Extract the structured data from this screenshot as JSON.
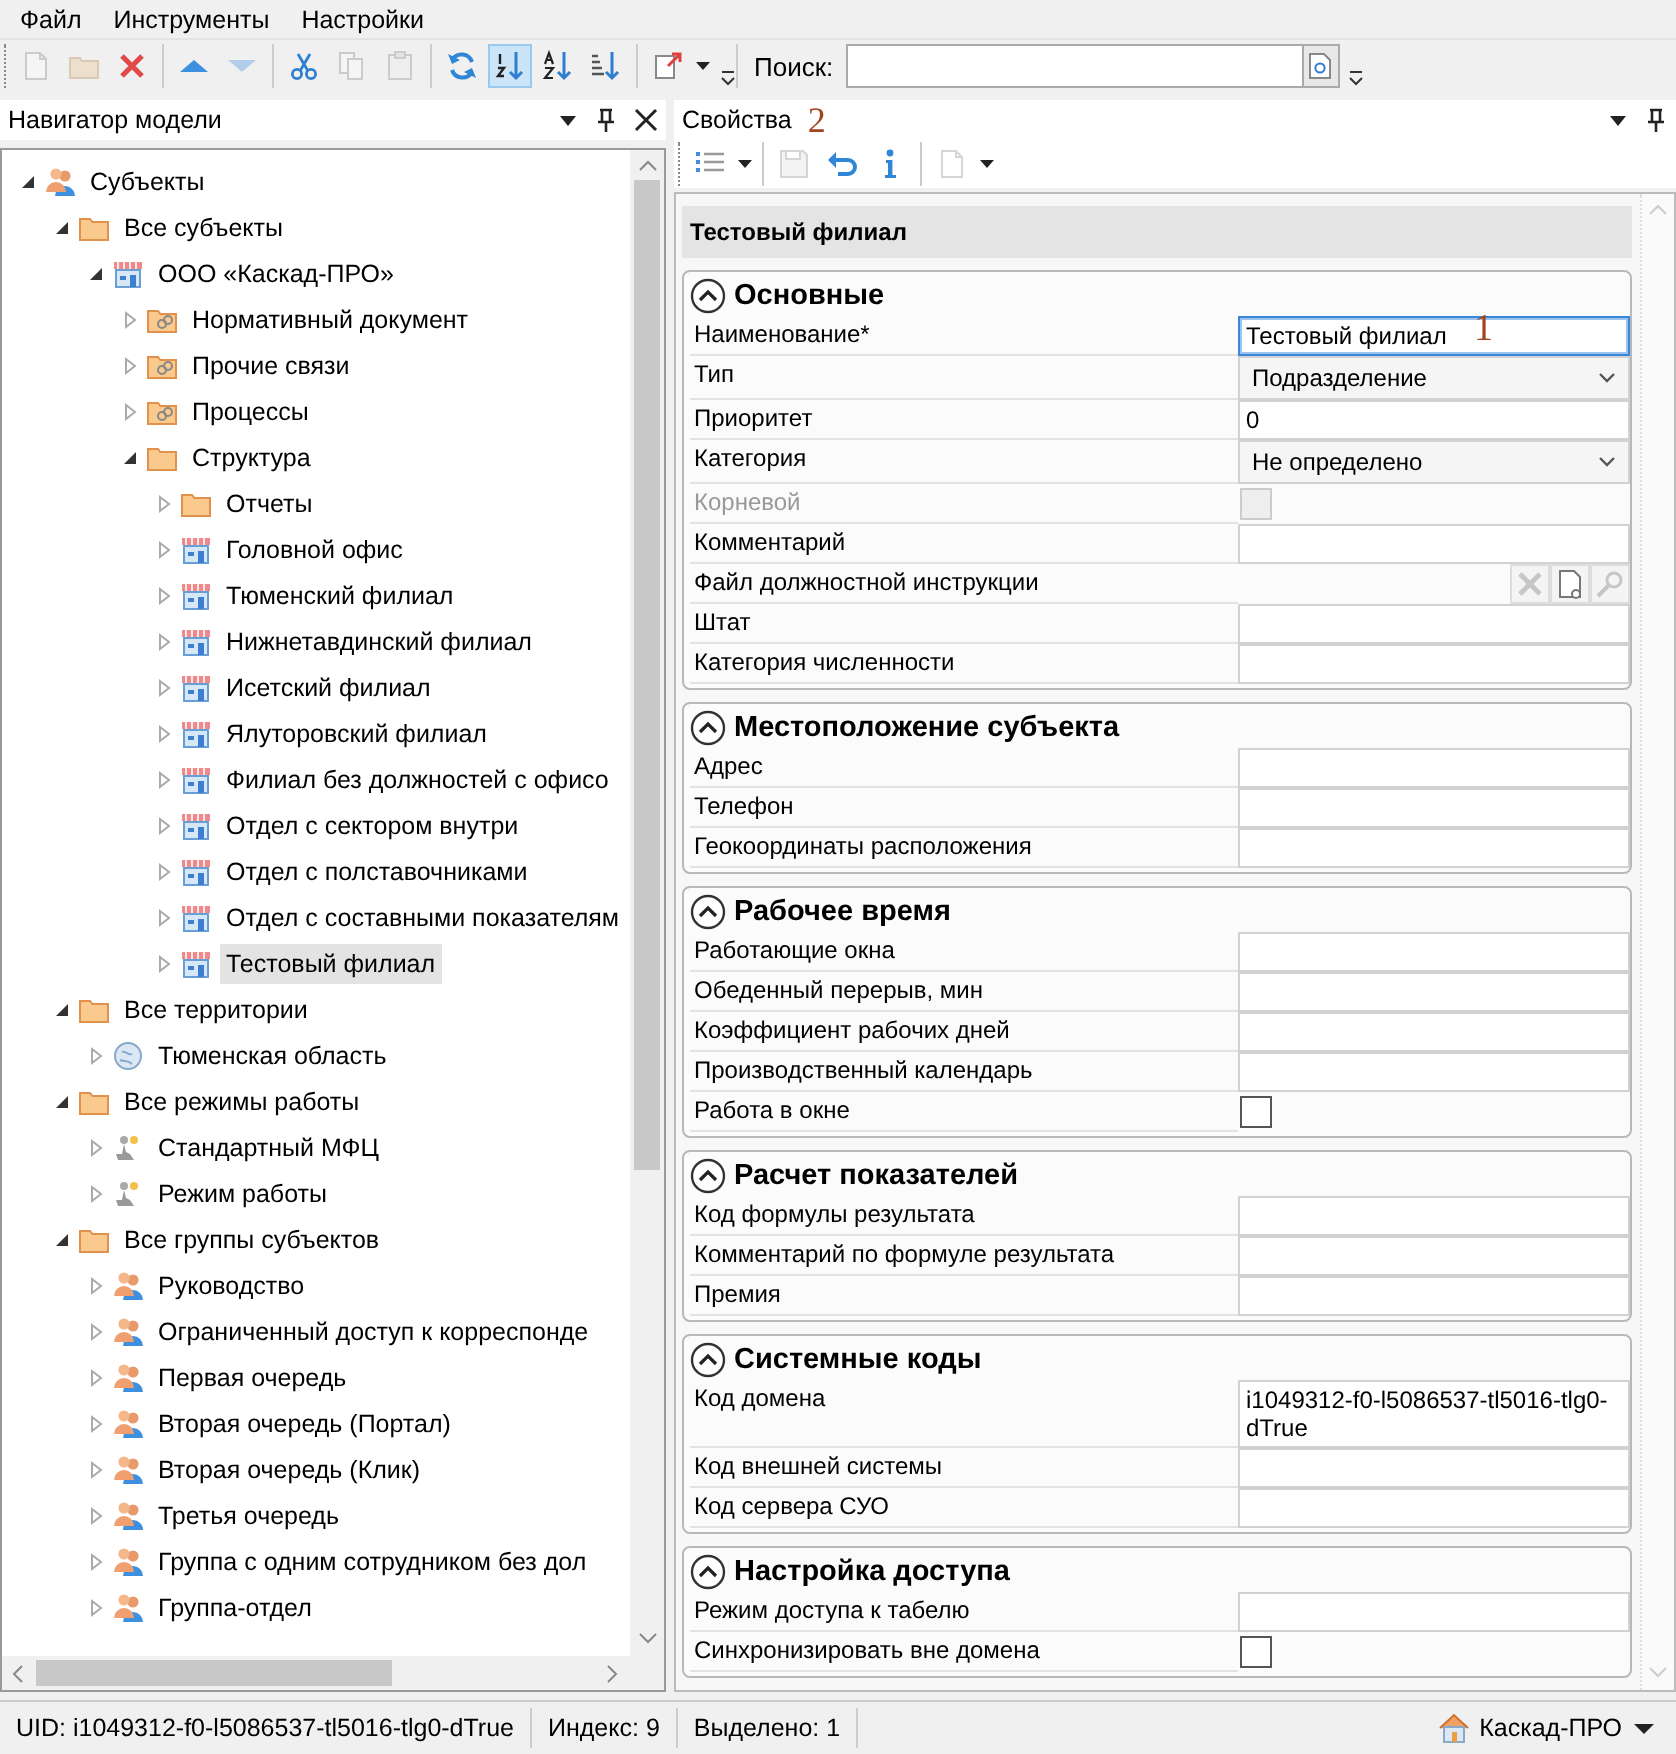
{
  "menu": [
    {
      "label": "Файл"
    },
    {
      "label": "Инструменты"
    },
    {
      "label": "Настройки"
    }
  ],
  "toolbar": {
    "groups": [
      [
        {
          "kind": "new",
          "disabled": true,
          "pressed": false
        },
        {
          "kind": "open",
          "disabled": true,
          "pressed": false
        },
        {
          "kind": "delete",
          "disabled": false,
          "pressed": false
        }
      ],
      [
        {
          "kind": "up",
          "disabled": false,
          "pressed": false
        },
        {
          "kind": "down",
          "disabled": true,
          "pressed": false
        }
      ],
      [
        {
          "kind": "cut",
          "disabled": false,
          "pressed": false
        },
        {
          "kind": "copy",
          "disabled": true,
          "pressed": false
        },
        {
          "kind": "paste",
          "disabled": true,
          "pressed": false
        }
      ],
      [
        {
          "kind": "refresh",
          "disabled": false,
          "pressed": false
        },
        {
          "kind": "sort-number",
          "disabled": false,
          "pressed": true
        },
        {
          "kind": "sort-alpha",
          "disabled": false,
          "pressed": false
        },
        {
          "kind": "sort-level",
          "disabled": false,
          "pressed": false
        }
      ],
      [
        {
          "kind": "export",
          "disabled": false,
          "pressed": false,
          "dropdown": true
        }
      ]
    ],
    "search_label": "Поиск:"
  },
  "navigator": {
    "title": "Навигатор модели",
    "tree": [
      {
        "label": "Субъекты",
        "kind": "people",
        "expanded": true,
        "selected": false,
        "children": [
          {
            "label": "Все субъекты",
            "kind": "folder",
            "expanded": true,
            "selected": false,
            "children": [
              {
                "label": "ООО «Каскад-ПРО»",
                "kind": "store",
                "expanded": true,
                "selected": false,
                "children": [
                  {
                    "label": "Нормативный документ",
                    "kind": "link-folder",
                    "expanded": false,
                    "selected": false
                  },
                  {
                    "label": "Прочие связи",
                    "kind": "link-folder",
                    "expanded": false,
                    "selected": false
                  },
                  {
                    "label": "Процессы",
                    "kind": "link-folder",
                    "expanded": false,
                    "selected": false
                  },
                  {
                    "label": "Структура",
                    "kind": "folder",
                    "expanded": true,
                    "selected": false,
                    "children": [
                      {
                        "label": "Отчеты",
                        "kind": "folder",
                        "expanded": false,
                        "selected": false
                      },
                      {
                        "label": "Головной офис",
                        "kind": "store",
                        "expanded": false,
                        "selected": false
                      },
                      {
                        "label": "Тюменский филиал",
                        "kind": "store",
                        "expanded": false,
                        "selected": false
                      },
                      {
                        "label": "Нижнетавдинский филиал",
                        "kind": "store",
                        "expanded": false,
                        "selected": false
                      },
                      {
                        "label": "Исетский филиал",
                        "kind": "store",
                        "expanded": false,
                        "selected": false
                      },
                      {
                        "label": "Ялуторовский филиал",
                        "kind": "store",
                        "expanded": false,
                        "selected": false
                      },
                      {
                        "label": "Филиал без должностей с офисо",
                        "kind": "store",
                        "expanded": false,
                        "selected": false
                      },
                      {
                        "label": "Отдел с сектором внутри",
                        "kind": "store",
                        "expanded": false,
                        "selected": false
                      },
                      {
                        "label": "Отдел с полставочниками",
                        "kind": "store",
                        "expanded": false,
                        "selected": false
                      },
                      {
                        "label": "Отдел с составными показателям",
                        "kind": "store",
                        "expanded": false,
                        "selected": false
                      },
                      {
                        "label": "Тестовый филиал",
                        "kind": "store",
                        "expanded": false,
                        "selected": true
                      }
                    ]
                  }
                ]
              }
            ]
          },
          {
            "label": "Все территории",
            "kind": "folder",
            "expanded": true,
            "selected": false,
            "children": [
              {
                "label": "Тюменская область",
                "kind": "globe",
                "expanded": false,
                "selected": false
              }
            ]
          },
          {
            "label": "Все режимы работы",
            "kind": "folder",
            "expanded": true,
            "selected": false,
            "children": [
              {
                "label": "Стандартный МФЦ",
                "kind": "figure",
                "expanded": false,
                "selected": false
              },
              {
                "label": "Режим работы",
                "kind": "figure",
                "expanded": false,
                "selected": false
              }
            ]
          },
          {
            "label": "Все группы субъектов",
            "kind": "folder",
            "expanded": true,
            "selected": false,
            "children": [
              {
                "label": "Руководство",
                "kind": "people",
                "expanded": false,
                "selected": false
              },
              {
                "label": "Ограниченный доступ к корреспонде",
                "kind": "people",
                "expanded": false,
                "selected": false
              },
              {
                "label": "Первая очередь",
                "kind": "people",
                "expanded": false,
                "selected": false
              },
              {
                "label": "Вторая очередь (Портал)",
                "kind": "people",
                "expanded": false,
                "selected": false
              },
              {
                "label": "Вторая очередь (Клик)",
                "kind": "people",
                "expanded": false,
                "selected": false
              },
              {
                "label": "Третья очередь",
                "kind": "people",
                "expanded": false,
                "selected": false
              },
              {
                "label": "Группа с одним сотрудником без дол",
                "kind": "people",
                "expanded": false,
                "selected": false
              },
              {
                "label": "Группа-отдел",
                "kind": "people",
                "expanded": false,
                "selected": false
              }
            ]
          }
        ]
      }
    ]
  },
  "properties": {
    "title": "Свойства",
    "annotation": "2",
    "toolbar": {
      "groups": [
        [
          {
            "kind": "list",
            "disabled": false,
            "pressed": false,
            "dropdown": true
          }
        ],
        [
          {
            "kind": "save",
            "disabled": true,
            "pressed": false
          },
          {
            "kind": "undo",
            "disabled": false,
            "pressed": false
          },
          {
            "kind": "info",
            "disabled": false,
            "pressed": false
          }
        ],
        [
          {
            "kind": "new",
            "disabled": true,
            "pressed": false,
            "dropdown": true
          }
        ]
      ]
    },
    "object_name": "Тестовый филиал",
    "groups": [
      {
        "title": "Основные",
        "expanded": true,
        "rows": [
          {
            "label": "Наименование*",
            "kind": "text",
            "value": "Тестовый филиал",
            "disabled": false,
            "focused": true,
            "annotation": "1"
          },
          {
            "label": "Тип",
            "kind": "select",
            "value": "Подразделение",
            "disabled": false
          },
          {
            "label": "Приоритет",
            "kind": "text",
            "value": "0",
            "disabled": false,
            "focused": false
          },
          {
            "label": "Категория",
            "kind": "select",
            "value": "Не определено",
            "disabled": false
          },
          {
            "label": "Корневой",
            "kind": "checkbox",
            "checked": false,
            "disabled": true
          },
          {
            "label": "Комментарий",
            "kind": "text",
            "disabled": false,
            "focused": false
          },
          {
            "label": "Файл должностной инструкции",
            "kind": "file",
            "disabled": false,
            "buttons": [
              {
                "kind": "clear",
                "disabled": true
              },
              {
                "kind": "browse",
                "disabled": false
              },
              {
                "kind": "find",
                "disabled": true
              }
            ]
          },
          {
            "label": "Штат",
            "kind": "text",
            "disabled": false,
            "focused": false
          },
          {
            "label": "Категория численности",
            "kind": "text",
            "disabled": false,
            "focused": false
          }
        ]
      },
      {
        "title": "Местоположение субъекта",
        "expanded": true,
        "rows": [
          {
            "label": "Адрес",
            "kind": "text",
            "disabled": false,
            "focused": false
          },
          {
            "label": "Телефон",
            "kind": "text",
            "disabled": false,
            "focused": false
          },
          {
            "label": "Геокоординаты расположения",
            "kind": "text",
            "disabled": false,
            "focused": false
          }
        ]
      },
      {
        "title": "Рабочее время",
        "expanded": true,
        "rows": [
          {
            "label": "Работающие окна",
            "kind": "text",
            "disabled": false,
            "focused": false
          },
          {
            "label": "Обеденный перерыв, мин",
            "kind": "text",
            "disabled": false,
            "focused": false
          },
          {
            "label": "Коэффициент рабочих дней",
            "kind": "text",
            "disabled": false,
            "focused": false
          },
          {
            "label": "Производственный календарь",
            "kind": "text",
            "disabled": false,
            "focused": false
          },
          {
            "label": "Работа в окне",
            "kind": "checkbox",
            "checked": false,
            "disabled": false
          }
        ]
      },
      {
        "title": "Расчет показателей",
        "expanded": true,
        "rows": [
          {
            "label": "Код формулы результата",
            "kind": "text",
            "disabled": false,
            "focused": false
          },
          {
            "label": "Комментарий по формуле результата",
            "kind": "text",
            "disabled": false,
            "focused": false
          },
          {
            "label": "Премия",
            "kind": "text",
            "disabled": false,
            "focused": false
          }
        ]
      },
      {
        "title": "Системные коды",
        "expanded": true,
        "rows": [
          {
            "label": "Код домена",
            "kind": "text",
            "value": "i1049312-f0-l5086537-tl5016-tlg0-dTrue",
            "disabled": false,
            "focused": false
          },
          {
            "label": "Код внешней системы",
            "kind": "text",
            "disabled": false,
            "focused": false
          },
          {
            "label": "Код сервера СУО",
            "kind": "text",
            "disabled": false,
            "focused": false
          }
        ]
      },
      {
        "title": "Настройка доступа",
        "expanded": true,
        "rows": [
          {
            "label": "Режим доступа к табелю",
            "kind": "text",
            "disabled": false,
            "focused": false
          },
          {
            "label": "Синхронизировать вне домена",
            "kind": "checkbox",
            "checked": false,
            "disabled": false
          }
        ]
      }
    ]
  },
  "status_bar": {
    "uid": "UID: i1049312-f0-l5086537-tl5016-tlg0-dTrue",
    "index": "Индекс: 9",
    "selected": "Выделено: 1",
    "workspace": "Каскад-ПРО"
  }
}
